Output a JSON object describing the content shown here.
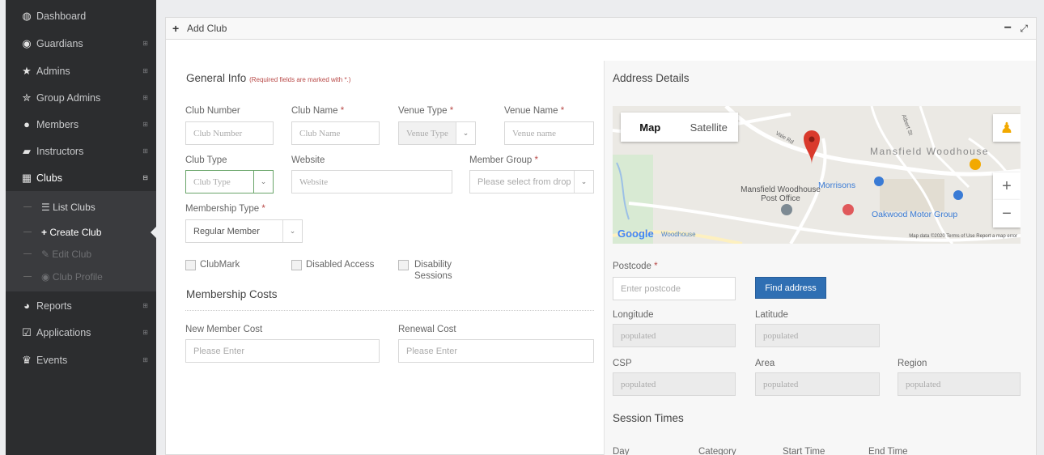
{
  "sidebar": {
    "items": [
      {
        "label": "Dashboard",
        "icon": "dashboard-icon",
        "glyph": "🎨"
      },
      {
        "label": "Guardians",
        "icon": "guardian-icon",
        "glyph": "◉"
      },
      {
        "label": "Admins",
        "icon": "star-icon",
        "glyph": "★"
      },
      {
        "label": "Group Admins",
        "icon": "star-outline-icon",
        "glyph": "✮"
      },
      {
        "label": "Members",
        "icon": "user-icon",
        "glyph": "●"
      },
      {
        "label": "Instructors",
        "icon": "graduation-icon",
        "glyph": "🎓"
      },
      {
        "label": "Clubs",
        "icon": "building-icon",
        "glyph": "▦"
      },
      {
        "label": "Reports",
        "icon": "pie-chart-icon",
        "glyph": "◕"
      },
      {
        "label": "Applications",
        "icon": "checkbox-icon",
        "glyph": "☑"
      },
      {
        "label": "Events",
        "icon": "trophy-icon",
        "glyph": "🏆"
      }
    ],
    "sub_items": [
      {
        "label": "List Clubs",
        "glyph": "☰"
      },
      {
        "label": "Create Club",
        "glyph": "+"
      },
      {
        "label": "Edit Club",
        "glyph": "✎"
      },
      {
        "label": "Club Profile",
        "glyph": "◉"
      }
    ]
  },
  "panel": {
    "title": "Add Club",
    "min_glyph": "−",
    "max_glyph": "⤢"
  },
  "general": {
    "heading": "General Info",
    "note": "(Required fields are marked with *.)",
    "fields": {
      "club_number": {
        "label": "Club Number",
        "placeholder": "Club Number"
      },
      "club_name": {
        "label": "Club Name",
        "placeholder": "Club Name"
      },
      "venue_type": {
        "label": "Venue Type",
        "placeholder": "Venue Type"
      },
      "venue_name": {
        "label": "Venue Name",
        "placeholder": "Venue name"
      },
      "club_type": {
        "label": "Club Type",
        "placeholder": "Club Type"
      },
      "website": {
        "label": "Website",
        "placeholder": "Website"
      },
      "member_group": {
        "label": "Member Group",
        "placeholder": "Please select from drop"
      },
      "membership_type": {
        "label": "Membership Type",
        "value": "Regular Member"
      }
    },
    "checkboxes": [
      {
        "label": "ClubMark"
      },
      {
        "label": "Disabled Access"
      },
      {
        "label": "Disability Sessions"
      }
    ]
  },
  "costs": {
    "heading": "Membership Costs",
    "new_member": {
      "label": "New Member Cost",
      "placeholder": "Please Enter"
    },
    "renewal": {
      "label": "Renewal Cost",
      "placeholder": "Please Enter"
    }
  },
  "address": {
    "heading": "Address Details",
    "map": {
      "map_label": "Map",
      "satellite_label": "Satellite",
      "places": {
        "town": "Mansfield Woodhouse",
        "post_office": "Mansfield Woodhouse Post Office",
        "morrisons": "Morrisons",
        "oakwood": "Oakwood Motor Group",
        "vale_rd": "Vale Rd",
        "albert_st": "Albert St",
        "woodhouse": "Woodhouse"
      },
      "google_label": "Google",
      "footer": "Map data ©2020   Terms of Use   Report a map error"
    },
    "postcode": {
      "label": "Postcode",
      "placeholder": "Enter postcode"
    },
    "find_button": "Find address",
    "longitude": {
      "label": "Longitude",
      "value": "populated"
    },
    "latitude": {
      "label": "Latitude",
      "value": "populated"
    },
    "csp": {
      "label": "CSP",
      "value": "populated"
    },
    "area": {
      "label": "Area",
      "value": "populated"
    },
    "region": {
      "label": "Region",
      "value": "populated"
    }
  },
  "sessions": {
    "heading": "Session Times",
    "columns": [
      "Day",
      "Category",
      "Start Time",
      "End Time"
    ]
  },
  "colors": {
    "sidebar": "#2c2d2f",
    "primary": "#2f6fb3",
    "required": "#b94a48"
  }
}
